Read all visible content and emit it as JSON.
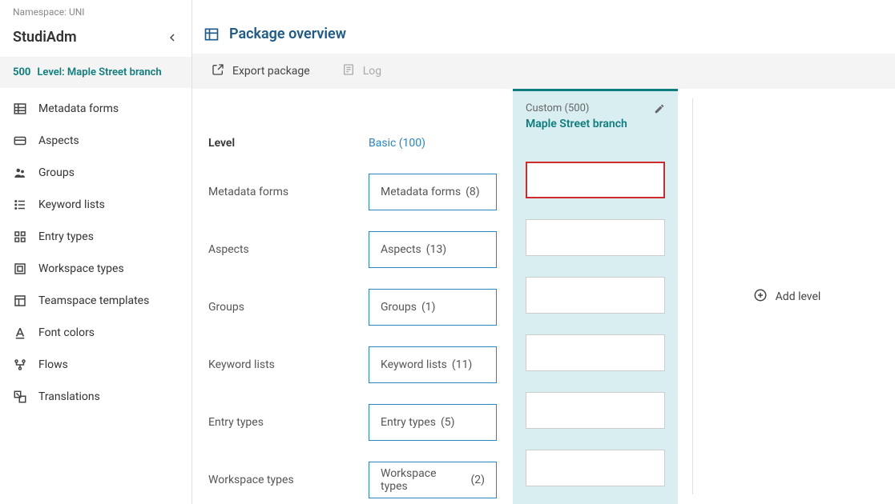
{
  "namespace_label": "Namespace: UNI",
  "app_title": "StudiAdm",
  "level": {
    "number": "500",
    "label": "Level: Maple Street branch"
  },
  "nav": [
    {
      "key": "metadata-forms",
      "label": "Metadata forms",
      "icon": "table"
    },
    {
      "key": "aspects",
      "label": "Aspects",
      "icon": "card"
    },
    {
      "key": "groups",
      "label": "Groups",
      "icon": "people"
    },
    {
      "key": "keyword-lists",
      "label": "Keyword lists",
      "icon": "list"
    },
    {
      "key": "entry-types",
      "label": "Entry types",
      "icon": "grid"
    },
    {
      "key": "workspace-types",
      "label": "Workspace types",
      "icon": "square"
    },
    {
      "key": "teamspace-templates",
      "label": "Teamspace templates",
      "icon": "template"
    },
    {
      "key": "font-colors",
      "label": "Font colors",
      "icon": "font"
    },
    {
      "key": "flows",
      "label": "Flows",
      "icon": "flow"
    },
    {
      "key": "translations",
      "label": "Translations",
      "icon": "translate"
    }
  ],
  "page_title": "Package overview",
  "toolbar": {
    "export_label": "Export package",
    "log_label": "Log"
  },
  "columns": {
    "level_label": "Level",
    "basic_header": "Basic (100)",
    "custom_tag": "Custom (500)",
    "custom_name": "Maple Street branch"
  },
  "rows": [
    {
      "label": "Metadata forms",
      "basic": {
        "text": "Metadata forms",
        "count": "(8)"
      },
      "custom_highlight": true
    },
    {
      "label": "Aspects",
      "basic": {
        "text": "Aspects",
        "count": "(13)"
      }
    },
    {
      "label": "Groups",
      "basic": {
        "text": "Groups",
        "count": "(1)"
      }
    },
    {
      "label": "Keyword lists",
      "basic": {
        "text": "Keyword lists",
        "count": "(11)"
      }
    },
    {
      "label": "Entry types",
      "basic": {
        "text": "Entry types",
        "count": "(5)"
      }
    },
    {
      "label": "Workspace types",
      "basic": {
        "text": "Workspace types",
        "count": "(2)"
      }
    }
  ],
  "add_level_label": "Add level"
}
